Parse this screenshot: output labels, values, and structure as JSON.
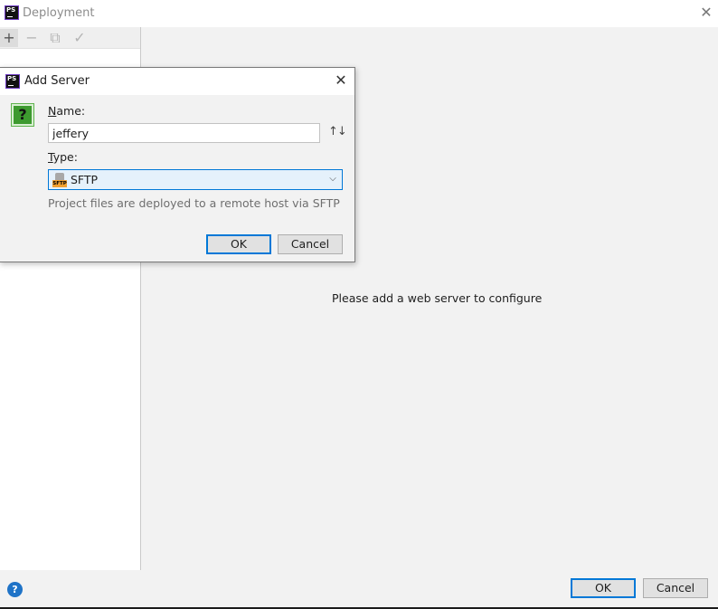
{
  "window": {
    "title": "Deployment",
    "logo_text": "PS",
    "close_glyph": "✕"
  },
  "toolbar": {
    "add_glyph": "+",
    "remove_glyph": "−",
    "copy_glyph": "⧉",
    "check_glyph": "✓"
  },
  "main": {
    "empty_message": "Please add a web server to configure"
  },
  "footer": {
    "help_glyph": "?",
    "ok_label": "OK",
    "cancel_label": "Cancel"
  },
  "dialog": {
    "title": "Add Server",
    "logo_text": "PS",
    "close_glyph": "✕",
    "question_glyph": "?",
    "name_label_mnemonic": "N",
    "name_label_rest": "ame:",
    "name_value": "jeffery",
    "sort_glyph": "↑↓",
    "type_label_mnemonic": "T",
    "type_label_rest": "ype:",
    "type_icon_text": "SFTP",
    "type_value": "SFTP",
    "dropdown_glyph": "⌵",
    "hint": "Project files are deployed to a remote host via SFTP",
    "ok_label": "OK",
    "cancel_label": "Cancel"
  },
  "colors": {
    "accent": "#0078d7",
    "help_icon": "#1f73c7",
    "question_icon": "#3d9a2f",
    "sftp_tag": "#f0a030"
  }
}
